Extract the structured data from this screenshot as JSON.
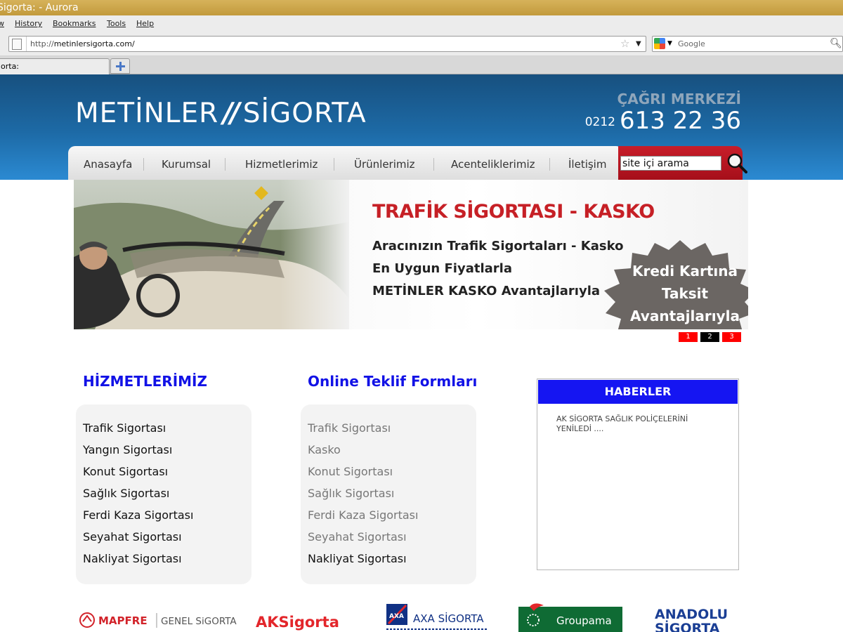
{
  "browser": {
    "title": "Sigorta: - Aurora",
    "menu": [
      "w",
      "History",
      "Bookmarks",
      "Tools",
      "Help"
    ],
    "url_protocol": "http://",
    "url_host": "metinlersigorta.com/",
    "search_placeholder": "Google",
    "tab_title": "orta:"
  },
  "header": {
    "logo_left": "METİNLER",
    "logo_slashes": "//",
    "logo_right": "SİGORTA",
    "call_center_label": "ÇAĞRI MERKEZİ",
    "phone_code": "0212",
    "phone_number": "613 22 36"
  },
  "nav": {
    "items": [
      "Anasayfa",
      "Kurumsal",
      "Hizmetlerimiz",
      "Ürünlerimiz",
      "Acenteliklerimiz",
      "İletişim"
    ],
    "search_value": "site içi arama"
  },
  "banner": {
    "headline": "TRAFİK SİGORTASI - KASKO",
    "lines": [
      "Aracınızın Trafik Sigortaları - Kasko",
      "En Uygun Fiyatlarla",
      "METİNLER KASKO Avantajlarıyla"
    ],
    "burst_lines": [
      "Kredi Kartına",
      "Taksit",
      "Avantajlarıyla"
    ],
    "slides": [
      "1",
      "2",
      "3"
    ],
    "active_slide": 2,
    "colors": {
      "slide_inactive": "#ff0000",
      "slide_active": "#000000"
    }
  },
  "services": {
    "title": "HİZMETLERİMİZ",
    "items": [
      "Trafik Sigortası",
      "Yangın Sigortası",
      "Konut Sigortası",
      "Sağlık Sigortası",
      "Ferdi Kaza Sigortası",
      "Seyahat Sigortası",
      "Nakliyat Sigortası"
    ]
  },
  "forms": {
    "title": "Online Teklif Formları",
    "items": [
      "Trafik Sigortası",
      "Kasko",
      "Konut Sigortası",
      "Sağlık Sigortası",
      "Ferdi Kaza Sigortası",
      "Seyahat Sigortası",
      "Nakliyat Sigortası"
    ]
  },
  "news": {
    "title": "HABERLER",
    "items": [
      "AK SİGORTA SAĞLIK POLİÇELERİNİ YENİLEDİ ...."
    ]
  },
  "partners": {
    "mapfre": "MAPFRE",
    "mapfre_sub": "GENEL SiGORTA",
    "ak": "AKSigorta",
    "axa": "AXA SİGORTA",
    "axa_tag": "AXA",
    "groupama": "Groupama",
    "anadolu_1": "ANADOLU",
    "anadolu_2": "SİGORTA"
  }
}
